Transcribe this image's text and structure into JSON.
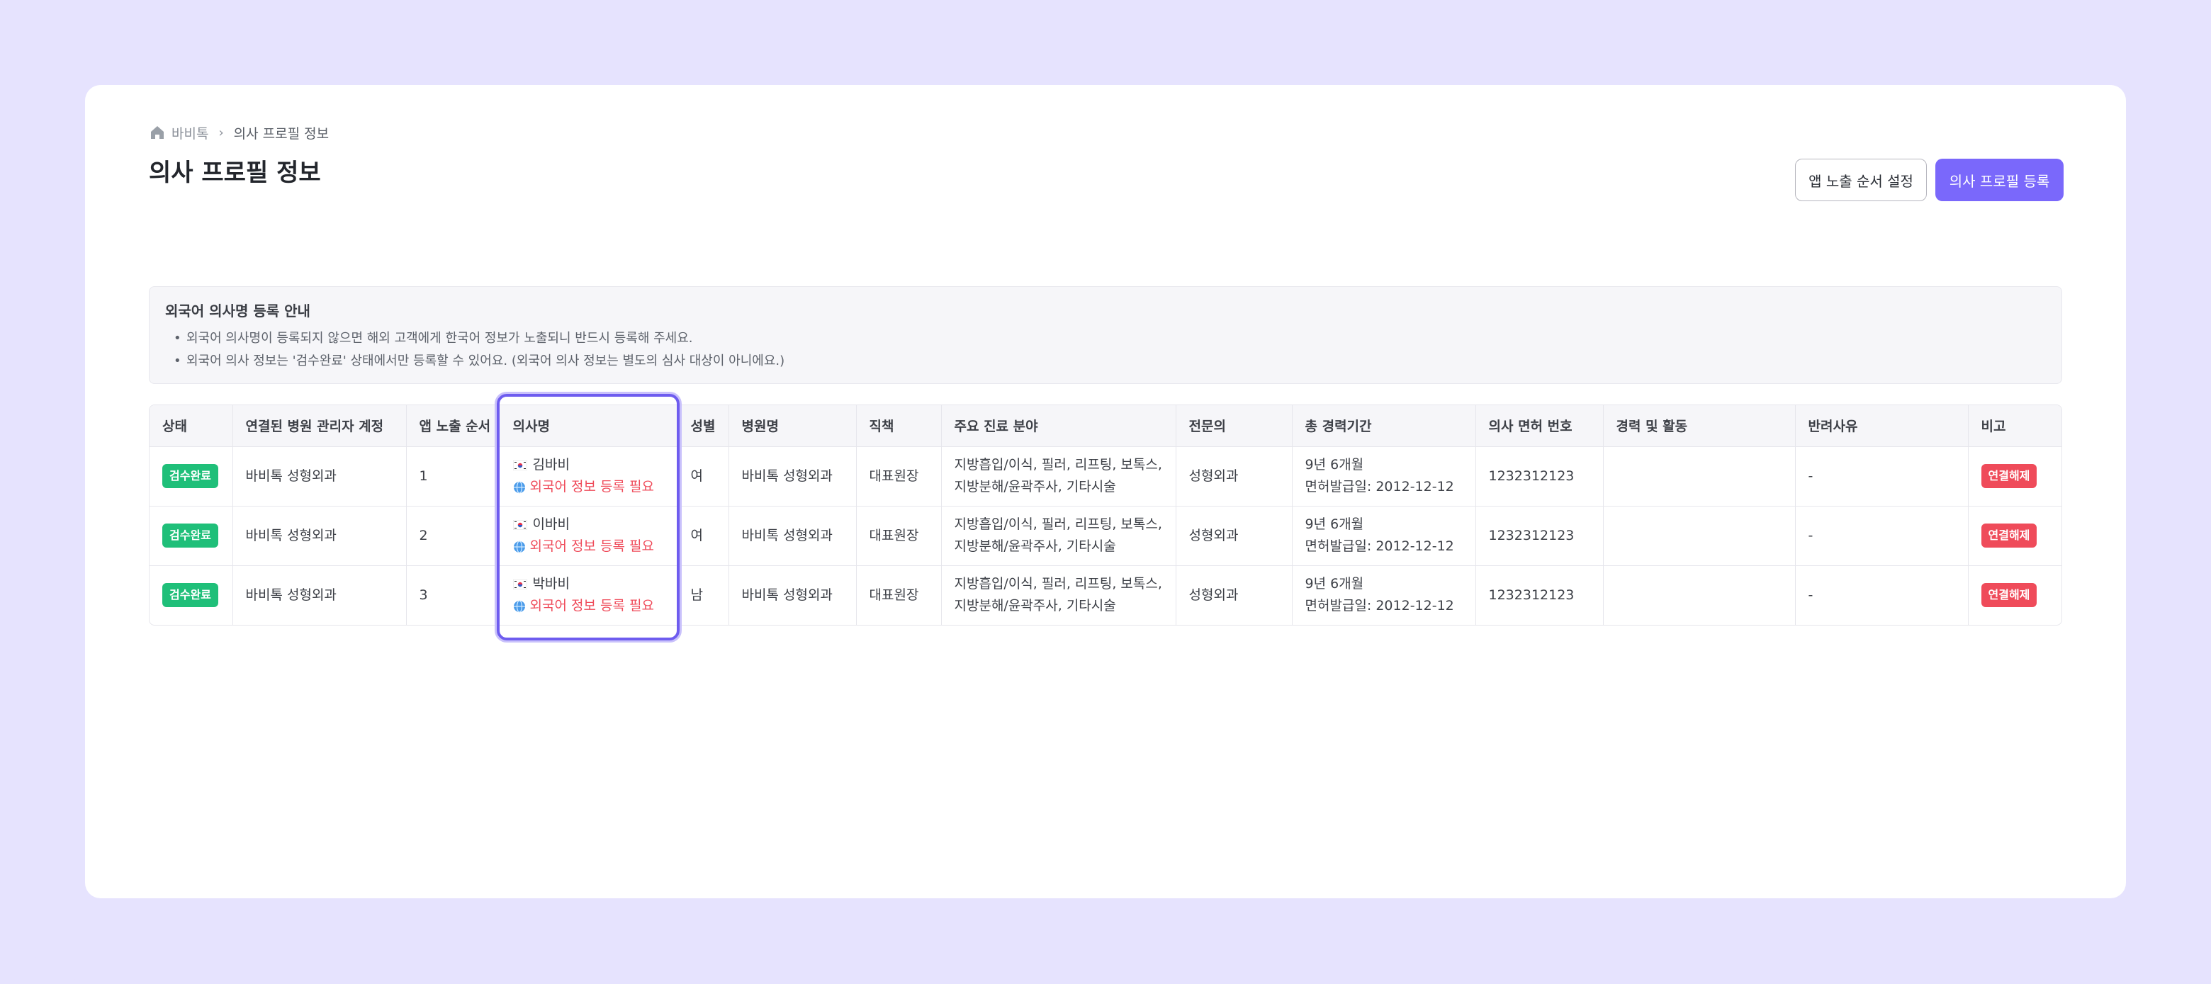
{
  "breadcrumb": {
    "home": "바비톡",
    "current": "의사 프로필 정보"
  },
  "page_title": "의사 프로필 정보",
  "buttons": {
    "order": "앱 노출 순서 설정",
    "register": "의사 프로필 등록"
  },
  "notice": {
    "title": "외국어 의사명 등록 안내",
    "items": [
      "외국어 의사명이 등록되지 않으면 해외 고객에게 한국어 정보가 노출되니 반드시 등록해 주세요.",
      "외국어 의사 정보는 '검수완료' 상태에서만 등록할 수 있어요. (외국어 의사 정보는 별도의 심사 대상이 아니에요.)"
    ]
  },
  "table": {
    "headers": [
      "상태",
      "연결된 병원 관리자 계정",
      "앱 노출 순서",
      "의사명",
      "성별",
      "병원명",
      "직책",
      "주요 진료 분야",
      "전문의",
      "총 경력기간",
      "의사 면허 번호",
      "경력 및 활동",
      "반려사유",
      "비고"
    ],
    "rows": [
      {
        "status": "검수완료",
        "account": "바비톡 성형외과",
        "order": "1",
        "name": "김바비",
        "foreign": "외국어 정보 등록 필요",
        "gender": "여",
        "hospital": "바비톡 성형외과",
        "position": "대표원장",
        "field_1": "지방흡입/이식, 필러, 리프팅, 보톡스,",
        "field_2": "지방분해/윤곽주사, 기타시술",
        "specialist": "성형외과",
        "career_1": "9년 6개월",
        "career_2": "면허발급일: 2012-12-12",
        "license": "1232312123",
        "activity": "",
        "reject": "-",
        "action": "연결해제"
      },
      {
        "status": "검수완료",
        "account": "바비톡 성형외과",
        "order": "2",
        "name": "이바비",
        "foreign": "외국어 정보 등록 필요",
        "gender": "여",
        "hospital": "바비톡 성형외과",
        "position": "대표원장",
        "field_1": "지방흡입/이식, 필러, 리프팅, 보톡스,",
        "field_2": "지방분해/윤곽주사, 기타시술",
        "specialist": "성형외과",
        "career_1": "9년 6개월",
        "career_2": "면허발급일: 2012-12-12",
        "license": "1232312123",
        "activity": "",
        "reject": "-",
        "action": "연결해제"
      },
      {
        "status": "검수완료",
        "account": "바비톡 성형외과",
        "order": "3",
        "name": "박바비",
        "foreign": "외국어 정보 등록 필요",
        "gender": "남",
        "hospital": "바비톡 성형외과",
        "position": "대표원장",
        "field_1": "지방흡입/이식, 필러, 리프팅, 보톡스,",
        "field_2": "지방분해/윤곽주사, 기타시술",
        "specialist": "성형외과",
        "career_1": "9년 6개월",
        "career_2": "면허발급일: 2012-12-12",
        "license": "1232312123",
        "activity": "",
        "reject": "-",
        "action": "연결해제"
      }
    ]
  },
  "colors": {
    "accent": "#7a68fb",
    "success": "#1fbf79",
    "danger": "#ef4b5a",
    "background": "#e6e3fe"
  }
}
